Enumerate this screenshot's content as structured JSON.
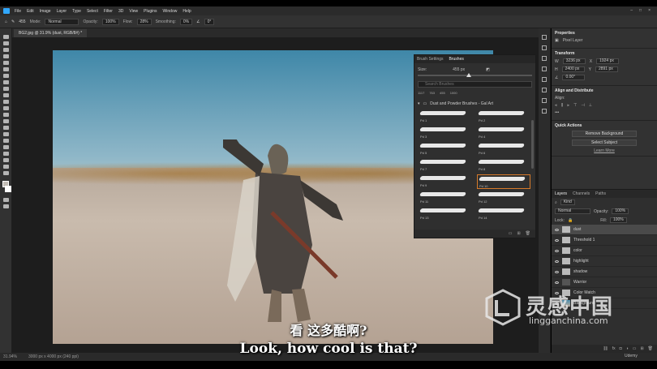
{
  "menubar": {
    "items": [
      "File",
      "Edit",
      "Image",
      "Layer",
      "Type",
      "Select",
      "Filter",
      "3D",
      "View",
      "Plugins",
      "Window",
      "Help"
    ],
    "window_controls": [
      "–",
      "□",
      "×"
    ]
  },
  "options_bar": {
    "mode_label": "Mode:",
    "mode_value": "Normal",
    "opacity_label": "Opacity:",
    "opacity_value": "100%",
    "flow_label": "Flow:",
    "flow_value": "28%",
    "smoothing_label": "Smoothing:",
    "smoothing_value": "0%",
    "angle_value": "0°",
    "brush_size": "455"
  },
  "document_tab": {
    "title": "BG2.jpg @ 31.9% (dust, RGB/8#) *"
  },
  "status_bar": {
    "zoom": "31.94%",
    "doc_info": "3000 px x 4000 px (240 ppi)"
  },
  "brush_panel": {
    "tabs": [
      "Brush Settings",
      "Brushes"
    ],
    "active_tab": "Brushes",
    "size_label": "Size:",
    "size_value": "455 px",
    "search_placeholder": "Search Brushes",
    "recent_sizes": [
      "1117",
      "763",
      "455",
      "1000"
    ],
    "group_name": "Dust and Powder Brushes - Gal Art",
    "brushes": [
      "Pd 1",
      "Pd 2",
      "Pd 3",
      "Pd 4",
      "Pd 5",
      "Pd 6",
      "Pd 7",
      "Pd 8",
      "Pd 9",
      "Pd 10",
      "Pd 11",
      "Pd 12",
      "Pd 13",
      "Pd 14"
    ],
    "selected_brush": "Pd 10"
  },
  "properties_panel": {
    "tabs": [
      "Properties"
    ],
    "layer_kind": "Pixel Layer",
    "transform_title": "Transform",
    "w_label": "W",
    "w_value": "3236 px",
    "x_label": "X",
    "x_value": "1924 px",
    "h_label": "H",
    "h_value": "2400 px",
    "y_label": "Y",
    "y_value": "2891 px",
    "angle_value": "0.00°",
    "align_title": "Align and Distribute",
    "align_label": "Align:",
    "quick_actions_title": "Quick Actions",
    "remove_bg": "Remove Background",
    "select_subject": "Select Subject",
    "learn_more": "Learn More"
  },
  "layers_panel": {
    "tabs": [
      "Layers",
      "Channels",
      "Paths"
    ],
    "active_tab": "Layers",
    "kind_filter": "Kind",
    "blend_mode": "Normal",
    "opacity_label": "Opacity:",
    "opacity_value": "100%",
    "lock_label": "Lock:",
    "fill_label": "Fill:",
    "fill_value": "100%",
    "layers": [
      {
        "name": "dust",
        "thumb": "light",
        "selected": true
      },
      {
        "name": "Threshold 1",
        "thumb": "light",
        "selected": false
      },
      {
        "name": "color",
        "thumb": "light",
        "selected": false
      },
      {
        "name": "highlight",
        "thumb": "light",
        "selected": false
      },
      {
        "name": "shadow",
        "thumb": "light",
        "selected": false
      },
      {
        "name": "Warrior",
        "thumb": "dark",
        "selected": false
      },
      {
        "name": "Color Match",
        "thumb": "light",
        "selected": false
      },
      {
        "name": "Background",
        "thumb": "photo",
        "selected": false
      }
    ]
  },
  "subtitles": {
    "chinese": "看 这多酷啊?",
    "english": "Look, how cool is that?"
  },
  "watermark": {
    "site_cn": "灵感中国",
    "url": "lingganchina.com"
  },
  "corner_brand": "Udemy"
}
